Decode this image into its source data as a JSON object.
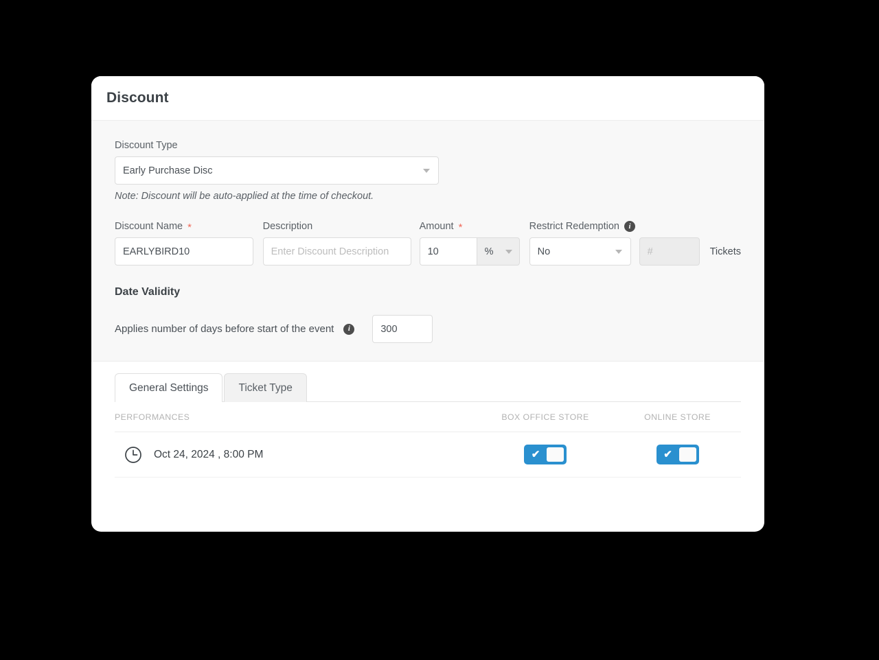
{
  "card": {
    "title": "Discount"
  },
  "form": {
    "discount_type": {
      "label": "Discount Type",
      "value": "Early Purchase Disc",
      "caret_icon": "chevron-down-icon"
    },
    "note": "Note: Discount will be auto-applied at the time of checkout.",
    "discount_name": {
      "label": "Discount Name",
      "required_marker": "*",
      "value": "EARLYBIRD10"
    },
    "description": {
      "label": "Description",
      "placeholder": "Enter Discount Description"
    },
    "amount": {
      "label": "Amount",
      "required_marker": "*",
      "value": "10",
      "unit": "%",
      "caret_icon": "chevron-down-icon"
    },
    "restrict_redemption": {
      "label": "Restrict Redemption",
      "info_icon": "info-icon",
      "info_glyph": "i",
      "value": "No",
      "caret_icon": "chevron-down-icon",
      "tickets_placeholder": "#",
      "tickets_label": "Tickets"
    }
  },
  "date_validity": {
    "title": "Date Validity",
    "applies_text": "Applies number of days before start of the event",
    "info_icon": "info-icon",
    "info_glyph": "i",
    "days_value": "300"
  },
  "tabs": [
    {
      "label": "General Settings",
      "active": true
    },
    {
      "label": "Ticket Type",
      "active": false
    }
  ],
  "table": {
    "headers": {
      "performances": "PERFORMANCES",
      "box_office_store": "BOX OFFICE STORE",
      "online_store": "ONLINE STORE"
    },
    "rows": [
      {
        "clock_icon": "clock-icon",
        "performance": "Oct 24, 2024 , 8:00 PM",
        "box_office_store_on": true,
        "online_store_on": true,
        "toggle_check_glyph": "✔"
      }
    ]
  },
  "colors": {
    "toggle_on": "#2a90cf",
    "required": "#f06a5a",
    "card_bg": "#ffffff",
    "form_bg": "#f8f8f8",
    "page_bg": "#000000"
  }
}
